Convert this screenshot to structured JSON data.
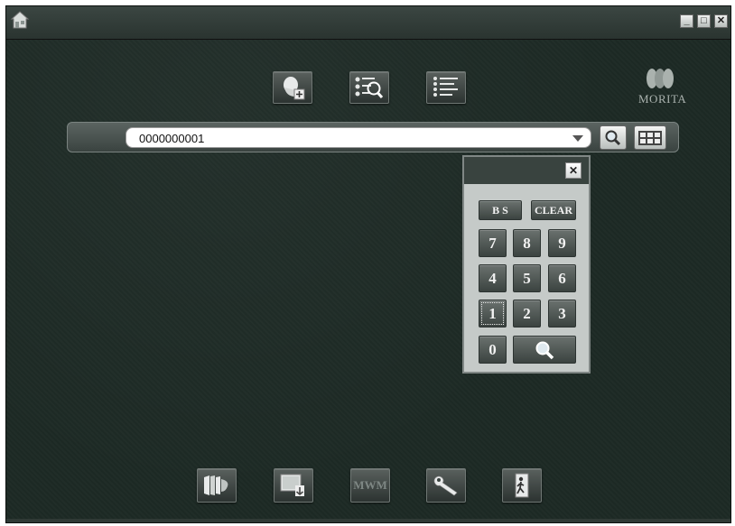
{
  "window": {
    "minimize_label": "_",
    "maximize_label": "□",
    "close_label": "✕"
  },
  "toolbar": {
    "icons": [
      "add-patient-icon",
      "patient-search-icon",
      "patient-list-icon"
    ]
  },
  "brand": {
    "logo_text": "MORITA"
  },
  "search": {
    "patient_id_value": "0000000001"
  },
  "keypad": {
    "close_label": "✕",
    "bs_label": "B S",
    "clear_label": "CLEAR",
    "keys": [
      "7",
      "8",
      "9",
      "4",
      "5",
      "6",
      "1",
      "2",
      "3",
      "0"
    ]
  },
  "bottom_toolbar": {
    "mwm_label": "MWM",
    "icons": [
      "image-archive-icon",
      "image-import-icon",
      "mwm-icon",
      "wrench-icon",
      "exit-icon"
    ]
  }
}
